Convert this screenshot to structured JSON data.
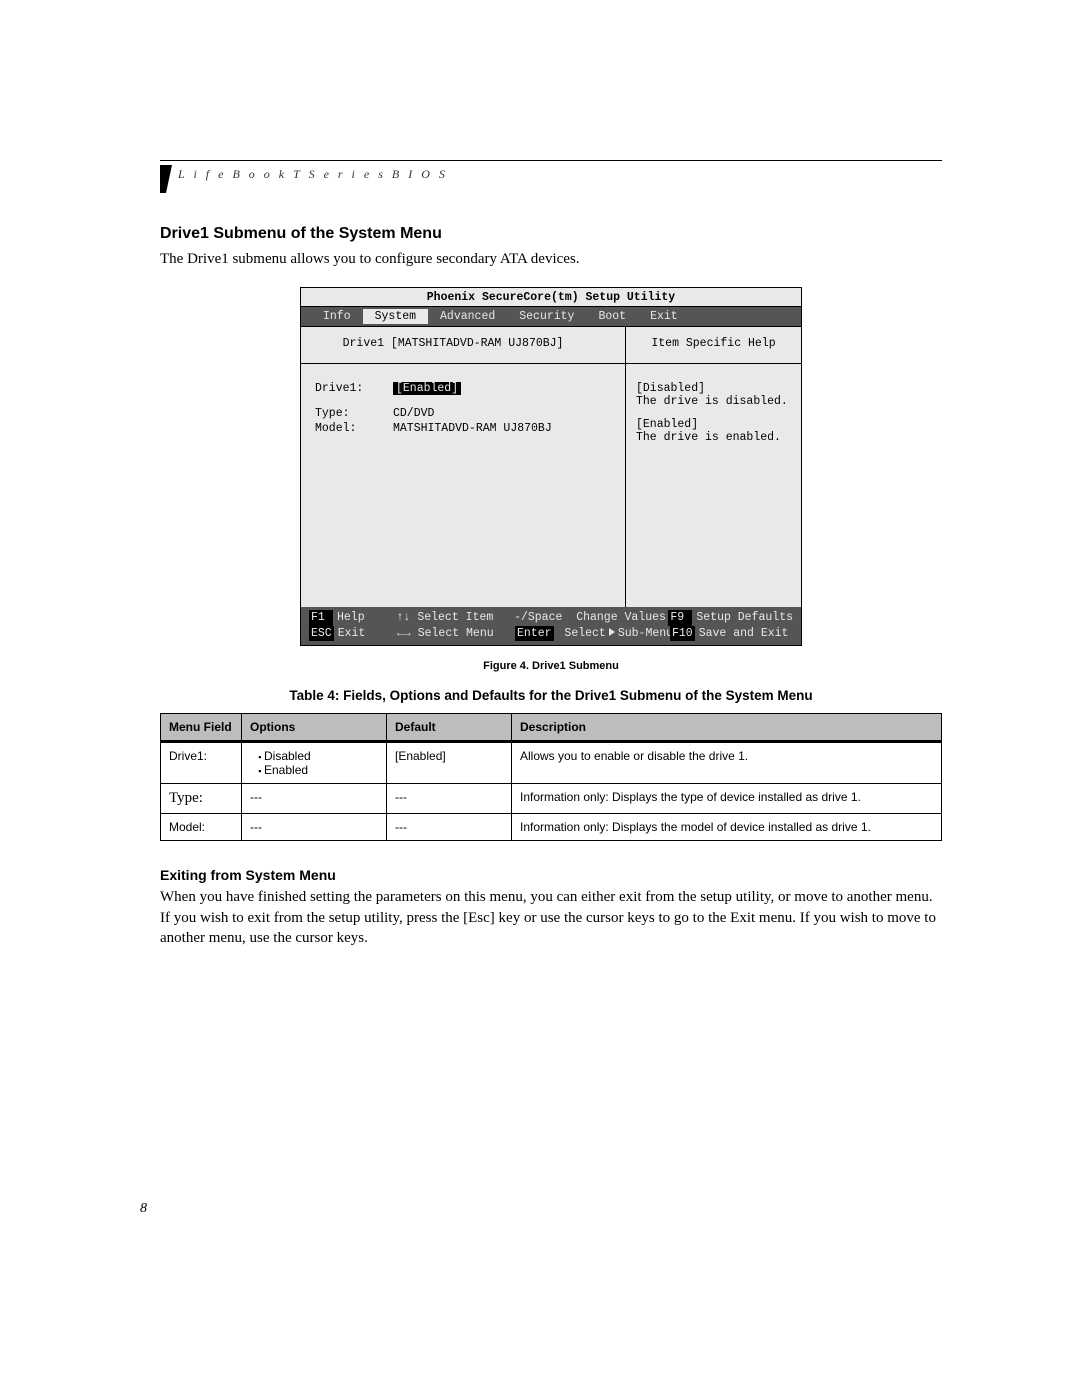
{
  "header": {
    "running": "L i f e B o o k   T   S e r i e s   B I O S"
  },
  "section_title": "Drive1 Submenu of the System Menu",
  "intro": "The Drive1 submenu allows you to configure secondary ATA devices.",
  "bios": {
    "title": "Phoenix SecureCore(tm) Setup Utility",
    "tabs": [
      "Info",
      "System",
      "Advanced",
      "Security",
      "Boot",
      "Exit"
    ],
    "active_tab": "System",
    "breadcrumb": "Drive1 [MATSHITADVD-RAM UJ870BJ]",
    "right_title": "Item Specific Help",
    "fields": {
      "drive1_label": "Drive1:",
      "drive1_value": "[Enabled]",
      "type_label": "Type:",
      "type_value": "CD/DVD",
      "model_label": "Model:",
      "model_value": "MATSHITADVD-RAM UJ870BJ"
    },
    "help": {
      "d_label": "[Disabled]",
      "d_text": "The drive is disabled.",
      "e_label": "[Enabled]",
      "e_text": "The drive is enabled."
    },
    "footer": {
      "f1": "F1",
      "help": "Help",
      "esc": "ESC",
      "exit": "Exit",
      "sel_item": "Select Item",
      "sel_menu": "Select Menu",
      "minus_space": "-/Space",
      "change": "Change Values",
      "enter": "Enter",
      "sub": "Select",
      "sub2": "Sub-Menu",
      "f9": "F9",
      "defaults": "Setup Defaults",
      "f10": "F10",
      "save": "Save and Exit",
      "updn": "↑↓",
      "lr": "←→"
    }
  },
  "figure_caption": "Figure 4.  Drive1 Submenu",
  "table_caption": "Table 4: Fields, Options and Defaults for the Drive1 Submenu of the System Menu",
  "table": {
    "headers": [
      "Menu Field",
      "Options",
      "Default",
      "Description"
    ],
    "rows": [
      {
        "field": "Drive1:",
        "options": [
          "Disabled",
          "Enabled"
        ],
        "default": "[Enabled]",
        "desc": "Allows you to enable or disable the drive 1."
      },
      {
        "field": "Type:",
        "options_text": "---",
        "default": "---",
        "desc": "Information only: Displays the type of device installed as drive 1."
      },
      {
        "field": "Model:",
        "options_text": "---",
        "default": "---",
        "desc": "Information only: Displays the model of device installed as drive 1."
      }
    ]
  },
  "exit_title": "Exiting from System Menu",
  "exit_body": "When you have finished setting the parameters on this menu, you can either exit from the setup utility, or move to another menu. If you wish to exit from the setup utility, press the [Esc] key or use the cursor keys to go to the Exit menu. If you wish to move to another menu, use the cursor keys.",
  "page_number": "8"
}
